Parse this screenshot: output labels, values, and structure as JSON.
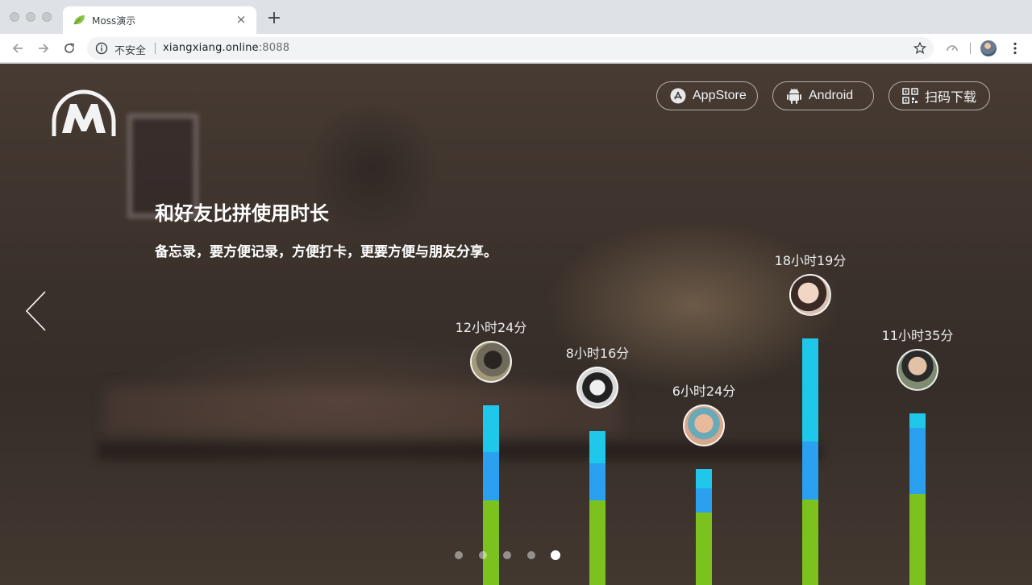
{
  "browser": {
    "tab": {
      "title": "Moss演示",
      "close_label": "×"
    },
    "new_tab_label": "+",
    "address_bar": {
      "security_label": "不安全",
      "url_host": "xiangxiang.online",
      "url_port": ":8088"
    }
  },
  "header": {
    "buttons": [
      {
        "label": "AppStore",
        "icon": "appstore-icon"
      },
      {
        "label": "Android",
        "icon": "android-icon"
      },
      {
        "label": "扫码下载",
        "icon": "qrcode-icon"
      }
    ]
  },
  "hero": {
    "title": "和好友比拼使用时长",
    "subtitle": "备忘录，要方便记录，方便打卡，更要方便与朋友分享。"
  },
  "colors": {
    "segment_top": "#1fc8e8",
    "segment_mid": "#2b9ff0",
    "segment_bottom": "#7cc21e"
  },
  "chart_data": {
    "type": "bar",
    "stacked": true,
    "items": [
      {
        "label": "12小时24分",
        "segments": [
          105,
          60,
          58
        ]
      },
      {
        "label": "8小时16分",
        "segments": [
          105,
          46,
          40
        ]
      },
      {
        "label": "6小时24分",
        "segments": [
          90,
          30,
          24
        ]
      },
      {
        "label": "18小时19分",
        "segments": [
          106,
          72,
          128
        ]
      },
      {
        "label": "11小时35分",
        "segments": [
          113,
          82,
          18
        ]
      }
    ]
  },
  "pager": {
    "count": 5,
    "active_index": 4
  }
}
